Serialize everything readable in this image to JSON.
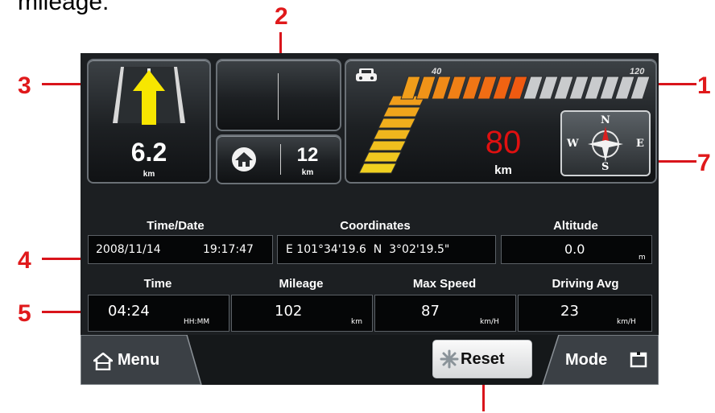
{
  "caption": "mileage.",
  "callouts": {
    "n1": "1",
    "n2": "2",
    "n3": "3",
    "n4": "4",
    "n5": "5",
    "n7": "7"
  },
  "lane": {
    "distance": "6.2",
    "unit": "km"
  },
  "home": {
    "distance": "12",
    "unit": "km"
  },
  "speedometer": {
    "scale_low": "40",
    "scale_high": "120",
    "current_speed": "80",
    "speed_unit": "km",
    "speed_color": "#e01010",
    "filled_fraction": 0.5
  },
  "compass": {
    "n": "N",
    "s": "S",
    "e": "E",
    "w": "W"
  },
  "info": {
    "time_date_label": "Time/Date",
    "date": "2008/11/14",
    "clock": "19:17:47",
    "coordinates_label": "Coordinates",
    "coordinates": "E 101°34'19.6  N  3°02'19.5\"",
    "altitude_label": "Altitude",
    "altitude": "0.0",
    "altitude_unit": "m",
    "time_label": "Time",
    "time": "04:24",
    "time_unit": "HH:MM",
    "mileage_label": "Mileage",
    "mileage": "102",
    "mileage_unit": "km",
    "max_speed_label": "Max Speed",
    "max_speed": "87",
    "max_speed_unit": "km/H",
    "driving_avg_label": "Driving Avg",
    "driving_avg": "23",
    "driving_avg_unit": "km/H"
  },
  "bottom": {
    "menu": "Menu",
    "reset": "Reset",
    "mode": "Mode"
  },
  "colors": {
    "callout": "#e0191b",
    "arrow": "#f7e600",
    "bar_low": "#f0d020",
    "bar_high": "#f05010"
  }
}
